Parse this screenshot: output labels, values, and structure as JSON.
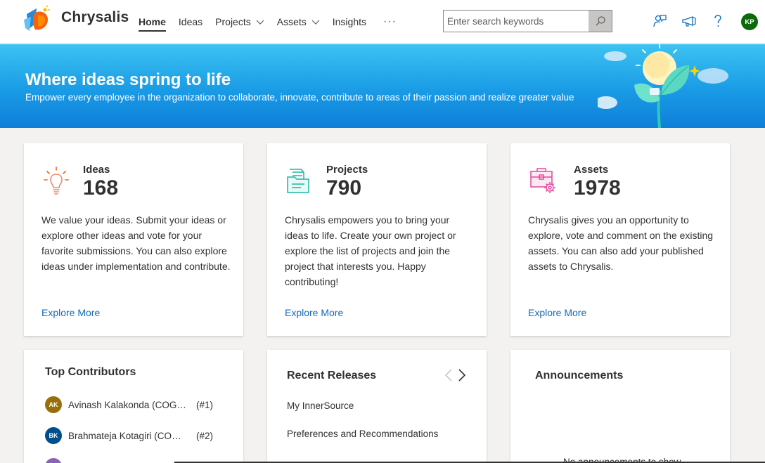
{
  "app": {
    "brand": "Chrysalis",
    "avatar_initials": "KP"
  },
  "nav": {
    "home": "Home",
    "ideas": "Ideas",
    "projects": "Projects",
    "assets": "Assets",
    "insights": "Insights",
    "more": "···"
  },
  "search": {
    "placeholder": "Enter search keywords",
    "value": ""
  },
  "header_icons": [
    "chat-person-icon",
    "megaphone-icon",
    "help-icon"
  ],
  "hero": {
    "title": "Where ideas spring to life",
    "subtitle": "Empower every employee in the organization to collaborate, innovate, contribute to areas of their passion and realize greater value"
  },
  "stats": {
    "ideas": {
      "label": "Ideas",
      "value": "168",
      "desc": "We value your ideas. Submit your ideas or explore other ideas and vote for your favorite submissions. You can also explore ideas under implementation and contribute.",
      "link": "Explore More"
    },
    "projects": {
      "label": "Projects",
      "value": "790",
      "desc": "Chrysalis empowers you to bring your ideas to life. Create your own project or explore the list of projects and join the project that interests you. Happy contributing!",
      "link": "Explore More"
    },
    "assets": {
      "label": "Assets",
      "value": "1978",
      "desc": "Chrysalis gives you an opportunity to explore, vote and comment on the existing assets. You can also add your published assets to Chrysalis.",
      "link": "Explore More"
    }
  },
  "contributors": {
    "title": "Top Contributors",
    "items": [
      {
        "initials": "AK",
        "name": "Avinash Kalakonda (COGNIZANT TECHNOLOGY SOLUTIONS)",
        "rank": "(#1)",
        "color": "#986f0b"
      },
      {
        "initials": "BK",
        "name": "Brahmateja Kotagiri (COGNIZANT TECHNOLOGY SOLUTIONS)",
        "rank": "(#2)",
        "color": "#004e8c"
      }
    ]
  },
  "releases": {
    "title": "Recent Releases",
    "items": [
      "My InnerSource",
      "Preferences and Recommendations"
    ]
  },
  "announcements": {
    "title": "Announcements",
    "empty": "No announcements to show"
  },
  "colors": {
    "accent": "#0f6cbd",
    "hero_top": "#3cc3f2",
    "hero_bottom": "#0f7fd8"
  }
}
